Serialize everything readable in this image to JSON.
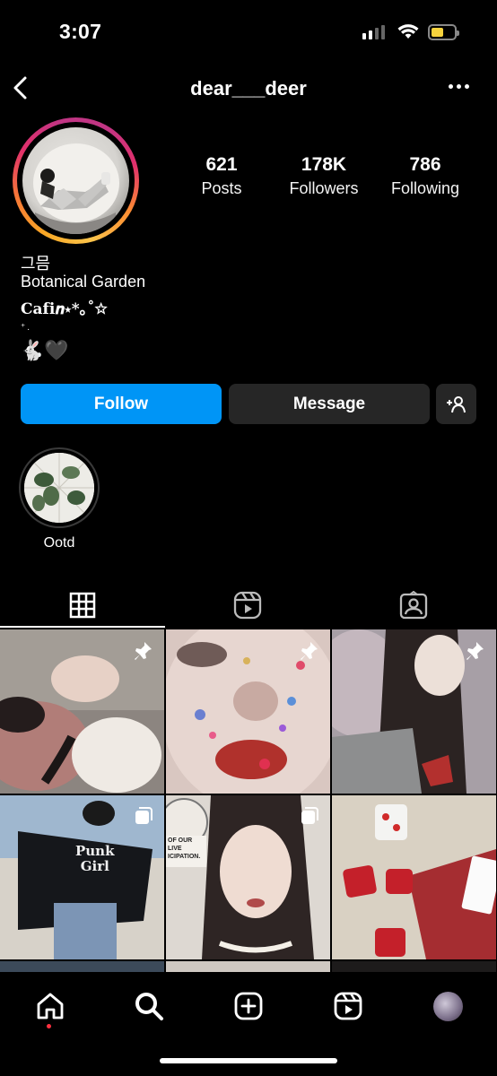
{
  "status_bar": {
    "time": "3:07"
  },
  "header": {
    "username": "dear___deer"
  },
  "profile": {
    "stats": [
      {
        "value": "621",
        "label": "Posts"
      },
      {
        "value": "178K",
        "label": "Followers"
      },
      {
        "value": "786",
        "label": "Following"
      }
    ],
    "bio": {
      "name": "그믐",
      "line1": "Botanical Garden",
      "line2": "𝐂𝐚𝐟𝐢𝒏⋆*｡˚✩",
      "line3": "⁺.",
      "line4": "🐇🖤"
    }
  },
  "actions": {
    "follow_label": "Follow",
    "message_label": "Message"
  },
  "highlights": [
    {
      "label": "Ootd"
    }
  ],
  "tabs": [
    "grid-icon",
    "reels-icon",
    "tagged-icon"
  ],
  "grid_posts": [
    {
      "badge": "pin-icon"
    },
    {
      "badge": "pin-icon"
    },
    {
      "badge": "pin-icon"
    },
    {
      "badge": "carousel-icon",
      "shirt_text": "Punk Girl"
    },
    {
      "badge": "carousel-icon",
      "sign_text": "OF OUR LIVE ICIPATION."
    },
    {
      "badge": "none"
    }
  ],
  "bottom_nav": [
    "home-icon",
    "search-icon",
    "create-icon",
    "reels-icon",
    "profile-avatar"
  ],
  "colors": {
    "follow": "#0095f6",
    "secondary_button": "#262626",
    "notification": "#ff3040"
  }
}
